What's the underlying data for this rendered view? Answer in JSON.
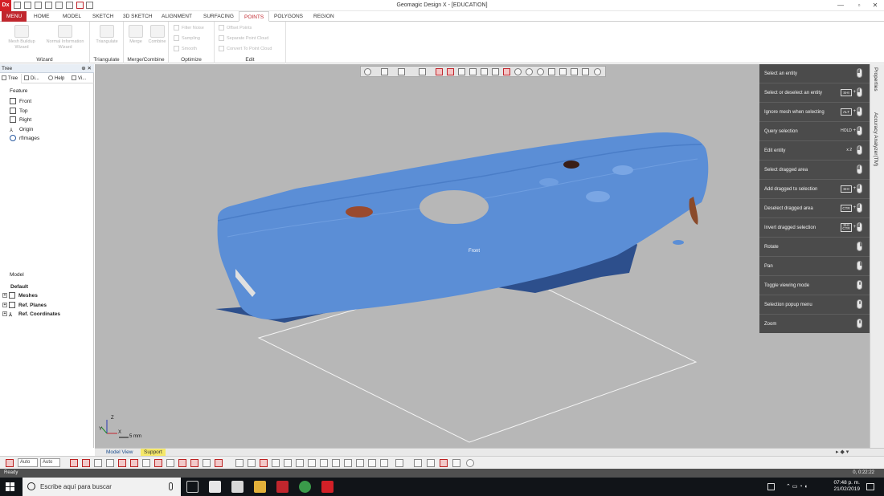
{
  "window": {
    "app_logo": "Dx",
    "title": "Geomagic Design X - [EDUCATION]",
    "minimize": "—",
    "maximize": "▫",
    "close": "✕"
  },
  "ribbon": {
    "tabs": [
      "MENU",
      "HOME",
      "MODEL",
      "SKETCH",
      "3D SKETCH",
      "ALIGNMENT",
      "SURFACING",
      "POINTS",
      "POLYGONS",
      "REGION"
    ],
    "active_tab": "POINTS",
    "groups": {
      "wizard": {
        "label": "Wizard",
        "mesh_buildup": "Mesh Buildup Wizard",
        "normal_info": "Normal Information Wizard"
      },
      "triangulate": {
        "label": "Triangulate",
        "triangulate": "Triangulate"
      },
      "merge_combine": {
        "label": "Merge/Combine",
        "merge": "Merge",
        "combine": "Combine"
      },
      "optimize": {
        "label": "Optimize",
        "filter_noise": "Filter Noise",
        "sampling": "Sampling",
        "smooth": "Smooth"
      },
      "edit": {
        "label": "Edit",
        "offset_points": "Offset Points",
        "separate_point_cloud": "Separate Point Cloud",
        "convert_to_point_cloud": "Convert To Point Cloud"
      }
    }
  },
  "left_panel": {
    "header": "Tree",
    "header_controls": "⊕ ✕",
    "tabs": [
      "Tree",
      "Di...",
      "Help",
      "Vi..."
    ],
    "feature_title": "Feature",
    "feature_items": [
      "Front",
      "Top",
      "Right",
      "Origin",
      "rfImages"
    ],
    "model_title": "Model",
    "model_root": "Default",
    "model_items": [
      "Meshes",
      "Ref. Planes",
      "Ref. Coordinates"
    ]
  },
  "viewport": {
    "view_label": "Front",
    "scale_label": "5 mm",
    "background": "#b7b7b7",
    "mesh_color": "#5b8ed6",
    "triad": {
      "x": "X",
      "y": "Y",
      "z": "Z"
    }
  },
  "mouse_help": [
    {
      "text": "Select an entity",
      "key": "",
      "mouse": "left"
    },
    {
      "text": "Select or deselect an entity",
      "key": "SHI",
      "mouse": "left"
    },
    {
      "text": "Ignore mesh when selecting",
      "key": "ALT",
      "mouse": "left"
    },
    {
      "text": "Query selection",
      "key": "HOLD",
      "mouse": "left"
    },
    {
      "text": "Edit entity",
      "key": "x 2",
      "mouse": "left"
    },
    {
      "text": "Select dragged area",
      "key": "",
      "mouse": "left"
    },
    {
      "text": "Add dragged to selection",
      "key": "SHI",
      "mouse": "left"
    },
    {
      "text": "Deselect dragged area",
      "key": "CTR",
      "mouse": "left"
    },
    {
      "text": "Invert dragged selection",
      "key": "SHI CTR",
      "mouse": "left"
    },
    {
      "text": "Rotate",
      "key": "",
      "mouse": "right"
    },
    {
      "text": "Pan",
      "key": "",
      "mouse": "right"
    },
    {
      "text": "Toggle viewing mode",
      "key": "",
      "mouse": "middle"
    },
    {
      "text": "Selection popup menu",
      "key": "",
      "mouse": "middle"
    },
    {
      "text": "Zoom",
      "key": "",
      "mouse": "middle"
    }
  ],
  "right_tabs": [
    "Properties",
    "Accuracy Analyzer(TM)"
  ],
  "bottom_tabs": [
    "Model View",
    "Support"
  ],
  "bottom_toolbar": {
    "combo1": "Auto",
    "combo2": "Auto"
  },
  "status": {
    "text": "Ready",
    "right": "0, 0:22:22"
  },
  "taskbar": {
    "search_placeholder": "Escribe aquí para buscar",
    "time": "07:48 p. m.",
    "date": "21/02/2019"
  }
}
